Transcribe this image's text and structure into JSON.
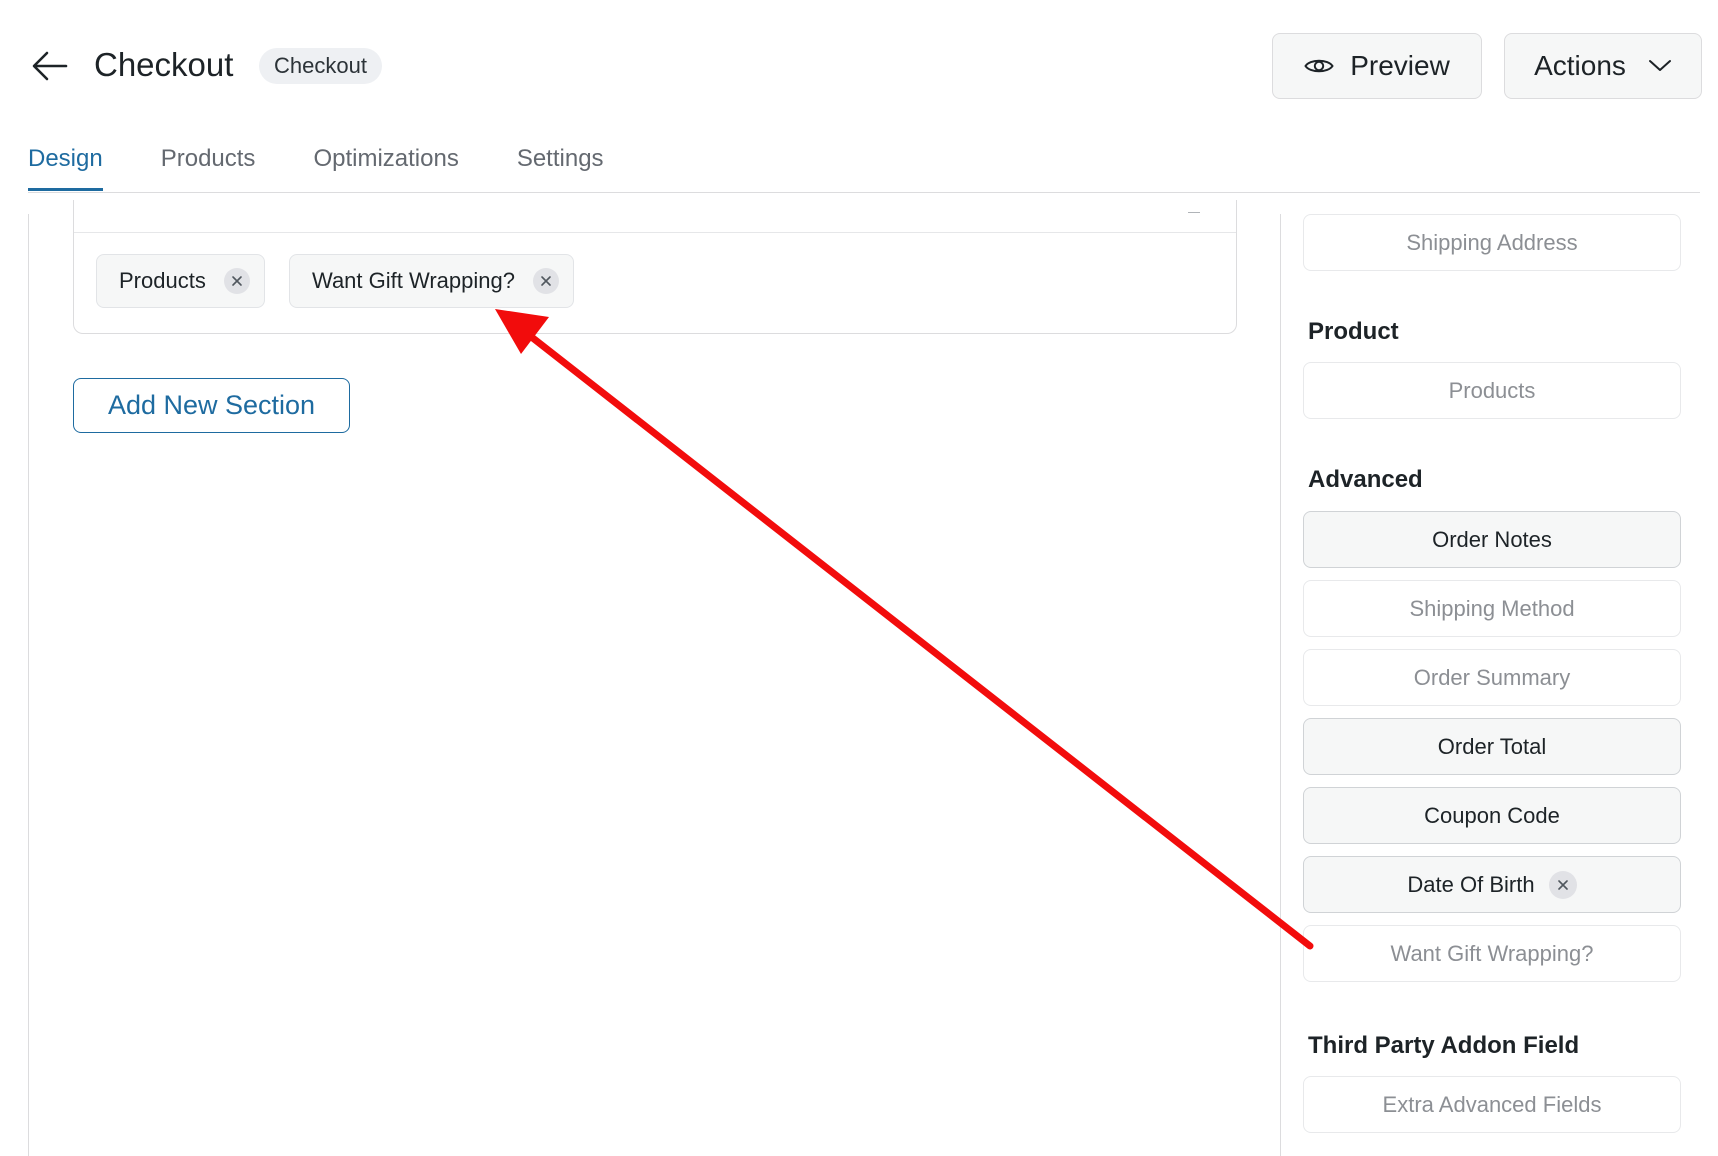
{
  "header": {
    "title": "Checkout",
    "type_badge": "Checkout",
    "preview_label": "Preview",
    "actions_label": "Actions"
  },
  "tabs": [
    {
      "label": "Design",
      "active": true
    },
    {
      "label": "Products",
      "active": false
    },
    {
      "label": "Optimizations",
      "active": false
    },
    {
      "label": "Settings",
      "active": false
    }
  ],
  "section": {
    "chips": [
      "Products",
      "Want Gift Wrapping?"
    ]
  },
  "add_section_label": "Add New Section",
  "sidebar": {
    "top_field": "Shipping Address",
    "groups": {
      "product": "Product",
      "advanced": "Advanced",
      "third_party": "Third Party Addon Field"
    },
    "product_fields": [
      "Products"
    ],
    "advanced_fields": [
      {
        "label": "Order Notes",
        "state": "enabled"
      },
      {
        "label": "Shipping Method",
        "state": "disabled"
      },
      {
        "label": "Order Summary",
        "state": "disabled"
      },
      {
        "label": "Order Total",
        "state": "enabled"
      },
      {
        "label": "Coupon Code",
        "state": "enabled"
      },
      {
        "label": "Date Of Birth",
        "state": "enabled",
        "removable": true
      },
      {
        "label": "Want Gift Wrapping?",
        "state": "disabled"
      }
    ],
    "third_party_fields": [
      "Extra Advanced Fields"
    ]
  },
  "colors": {
    "accent": "#1e6ba0",
    "annotation_arrow": "#f20c0c"
  },
  "icons": {
    "back": "arrow-left-icon",
    "preview": "eye-icon",
    "actions": "chevron-down-icon",
    "remove": "close-icon"
  }
}
